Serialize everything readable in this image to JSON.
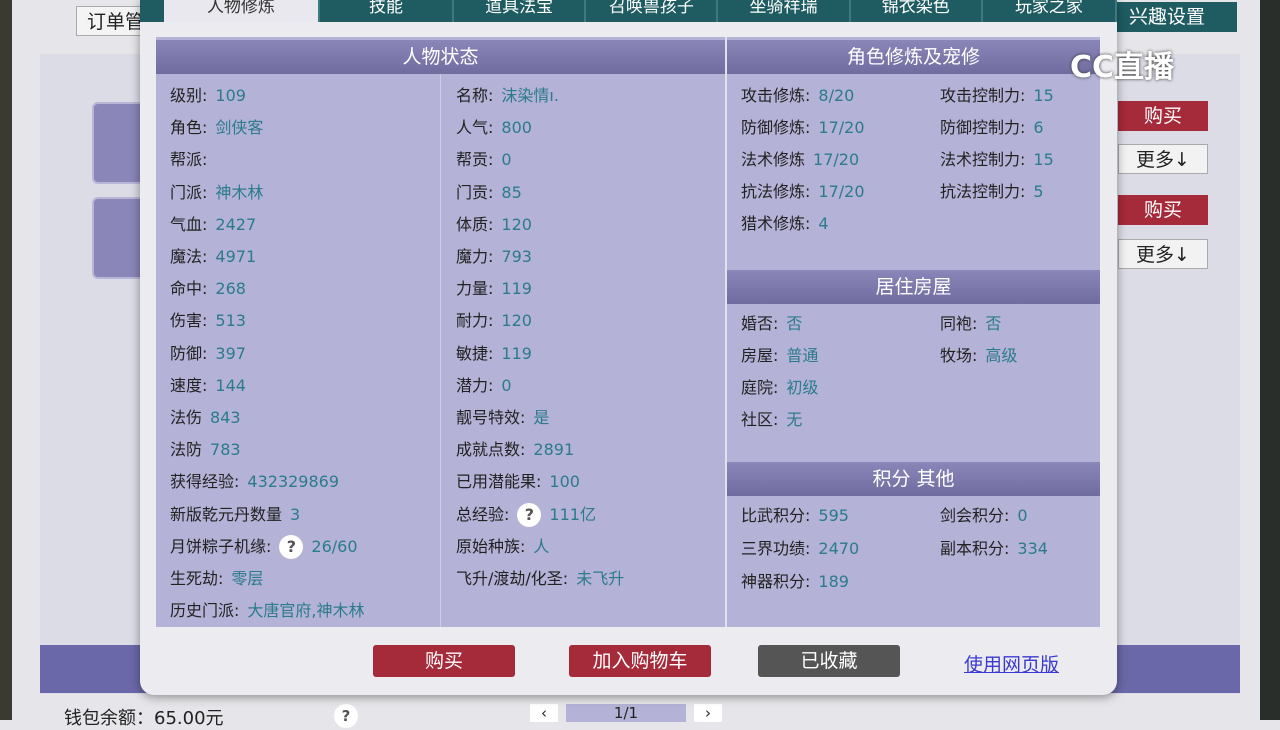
{
  "tabs": [
    "人物修炼",
    "技能",
    "道具法宝",
    "召唤兽孩子",
    "坐骑祥瑞",
    "锦衣染色",
    "玩家之家"
  ],
  "background": {
    "order_label": "订单管",
    "interest": "兴趣设置",
    "buy": "购买",
    "more": "更多↓",
    "wallet": "钱包余额：65.00元",
    "page": "1/1",
    "prev": "‹",
    "next": "›",
    "help": "?"
  },
  "logo": "CC直播",
  "status": {
    "title": "人物状态",
    "rows": [
      [
        {
          "l": "级别:",
          "v": "109"
        },
        {
          "l": "名称:",
          "v": "沫染情ı."
        }
      ],
      [
        {
          "l": "角色:",
          "v": "剑侠客"
        },
        {
          "l": "人气:",
          "v": "800"
        }
      ],
      [
        {
          "l": "帮派:",
          "v": ""
        },
        {
          "l": "帮贡:",
          "v": "0"
        }
      ],
      [
        {
          "l": "门派:",
          "v": "神木林"
        },
        {
          "l": "门贡:",
          "v": "85"
        }
      ],
      [
        {
          "l": "气血:",
          "v": "2427"
        },
        {
          "l": "体质:",
          "v": "120"
        }
      ],
      [
        {
          "l": "魔法:",
          "v": "4971"
        },
        {
          "l": "魔力:",
          "v": "793"
        }
      ],
      [
        {
          "l": "命中:",
          "v": "268"
        },
        {
          "l": "力量:",
          "v": "119"
        }
      ],
      [
        {
          "l": "伤害:",
          "v": "513"
        },
        {
          "l": "耐力:",
          "v": "120"
        }
      ],
      [
        {
          "l": "防御:",
          "v": "397"
        },
        {
          "l": "敏捷:",
          "v": "119"
        }
      ],
      [
        {
          "l": "速度:",
          "v": "144"
        },
        {
          "l": "潜力:",
          "v": "0"
        }
      ],
      [
        {
          "l": "法伤",
          "v": "843"
        },
        {
          "l": "靓号特效:",
          "v": "是"
        }
      ],
      [
        {
          "l": "法防",
          "v": "783"
        },
        {
          "l": "成就点数:",
          "v": "2891"
        }
      ],
      [
        {
          "l": "获得经验:",
          "v": "432329869"
        },
        {
          "l": "已用潜能果:",
          "v": "100"
        }
      ],
      [
        {
          "l": "新版乾元丹数量",
          "v": "3"
        },
        {
          "l": "总经验:",
          "v": "111亿",
          "q": true
        }
      ],
      [
        {
          "l": "月饼粽子机缘:",
          "v": "26/60",
          "q": true
        },
        {
          "l": "原始种族:",
          "v": "人"
        }
      ],
      [
        {
          "l": "生死劫:",
          "v": "零层"
        },
        {
          "l": "飞升/渡劫/化圣:",
          "v": "未飞升"
        }
      ],
      [
        {
          "l": "历史门派:",
          "v": "大唐官府,神木林"
        }
      ]
    ]
  },
  "cultivation": {
    "title": "角色修炼及宠修",
    "rows": [
      [
        {
          "l": "攻击修炼:",
          "v": "8/20"
        },
        {
          "l": "攻击控制力:",
          "v": "15"
        }
      ],
      [
        {
          "l": "防御修炼:",
          "v": "17/20"
        },
        {
          "l": "防御控制力:",
          "v": "6"
        }
      ],
      [
        {
          "l": "法术修炼",
          "v": "17/20"
        },
        {
          "l": "法术控制力:",
          "v": "15"
        }
      ],
      [
        {
          "l": "抗法修炼:",
          "v": "17/20"
        },
        {
          "l": "抗法控制力:",
          "v": "5"
        }
      ],
      [
        {
          "l": "猎术修炼:",
          "v": "4"
        }
      ]
    ]
  },
  "house": {
    "title": "居住房屋",
    "rows": [
      [
        {
          "l": "婚否:",
          "v": "否"
        },
        {
          "l": "同袍:",
          "v": "否"
        }
      ],
      [
        {
          "l": "房屋:",
          "v": "普通"
        },
        {
          "l": "牧场:",
          "v": "高级"
        }
      ],
      [
        {
          "l": "庭院:",
          "v": "初级"
        }
      ],
      [
        {
          "l": "社区:",
          "v": "无"
        }
      ]
    ]
  },
  "points": {
    "title": "积分 其他",
    "rows": [
      [
        {
          "l": "比武积分:",
          "v": "595"
        },
        {
          "l": "剑会积分:",
          "v": "0"
        }
      ],
      [
        {
          "l": "三界功绩:",
          "v": "2470"
        },
        {
          "l": "副本积分:",
          "v": "334"
        }
      ],
      [
        {
          "l": "神器积分:",
          "v": "189"
        }
      ]
    ]
  },
  "footer": {
    "buy": "购买",
    "cart": "加入购物车",
    "collected": "已收藏",
    "web": "使用网页版"
  },
  "colors": {
    "tab": "#1e5c62",
    "header": "#7c78aa",
    "panel": "#b4b2d6",
    "buy": "#a52a3a",
    "collected": "#555555",
    "value": "#2b7b8c"
  }
}
